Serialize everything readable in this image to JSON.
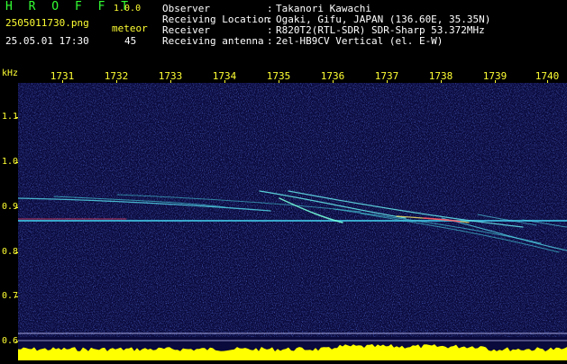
{
  "header": {
    "app_name": "H R O F F T",
    "app_version": "1.0.0",
    "file_name": "2505011730.png",
    "datetime": "25.05.01 17:30",
    "meteor_label": "meteor",
    "meteor_count": "45",
    "info": [
      {
        "label": "Observer",
        "value": "Takanori Kawachi"
      },
      {
        "label": "Receiving Location",
        "value": "Ogaki, Gifu, JAPAN (136.60E, 35.35N)"
      },
      {
        "label": "Receiver",
        "value": "R820T2(RTL-SDR) SDR-Sharp 53.372MHz"
      },
      {
        "label": "Receiving antenna",
        "value": "2el-HB9CV Vertical (el. E-W)"
      }
    ]
  },
  "axes": {
    "y_unit": "kHz",
    "y_ticks": [
      "1.1",
      "1.0",
      "0.9",
      "0.8",
      "0.7",
      "0.6"
    ],
    "x_ticks": [
      "1731",
      "1732",
      "1733",
      "1734",
      "1735",
      "1736",
      "1737",
      "1738",
      "1739",
      "1740"
    ]
  },
  "colors": {
    "header_text": "#ffff33",
    "background": "#0a0a3c",
    "noise": "#2a3cc8",
    "carrier": "#55ddee",
    "hot": "#ff4466",
    "strip_yellow": "#ffff00",
    "strip_cyan": "#00ccff"
  }
}
